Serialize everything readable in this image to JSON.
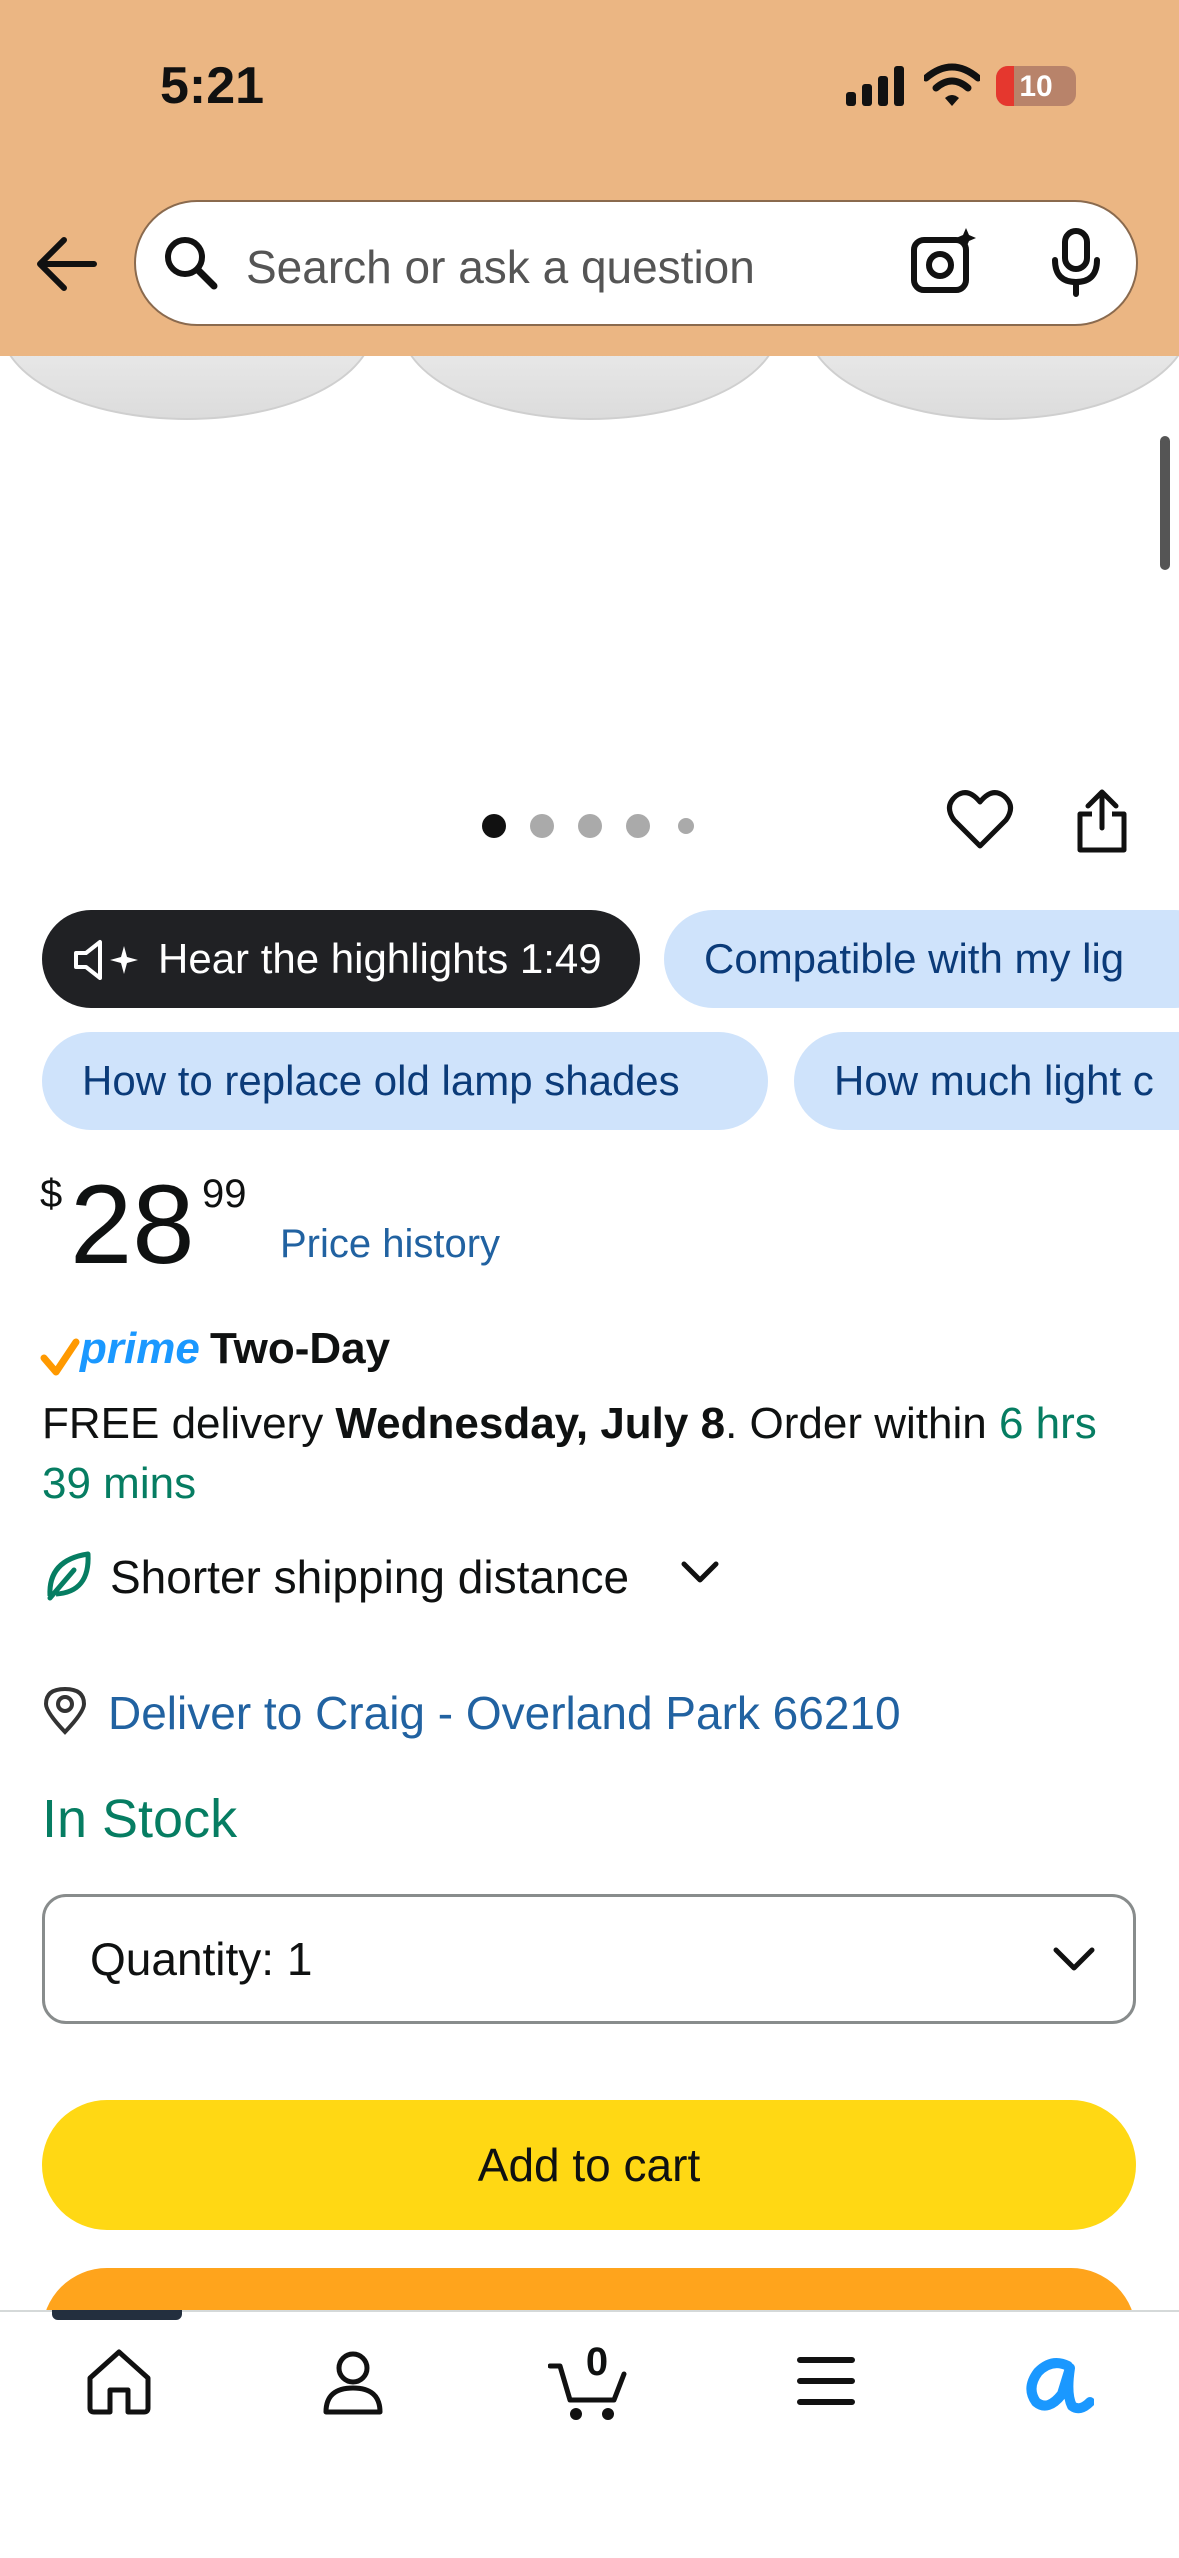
{
  "status_bar": {
    "time": "5:21",
    "battery": "10"
  },
  "search": {
    "placeholder": "Search or ask a question"
  },
  "chips": {
    "row1": [
      "Hear the highlights 1:49",
      "Compatible with my lig"
    ],
    "row2": [
      "How to replace old lamp shades",
      "How much light c"
    ]
  },
  "price": {
    "symbol": "$",
    "whole": "28",
    "fraction": "99",
    "history_link": "Price history"
  },
  "prime": {
    "badge": "prime",
    "label": "Two-Day"
  },
  "delivery": {
    "prefix": "FREE delivery ",
    "date": "Wednesday, July 8",
    "middle": ". Order within ",
    "countdown": "6 hrs 39 mins"
  },
  "shipping_note": "Shorter shipping distance",
  "deliver_to": "Deliver to Craig - Overland Park 66210",
  "stock_status": "In Stock",
  "quantity": {
    "label": "Quantity:",
    "value": "1"
  },
  "buttons": {
    "add_to_cart": "Add to cart"
  },
  "image_carousel": {
    "total": 5,
    "active": 1
  },
  "nav": {
    "cart_count": "0"
  },
  "colors": {
    "header": "#EBB683",
    "add_to_cart": "#FFD814",
    "buy_now": "#FFA41C",
    "link": "#2162A1",
    "in_stock": "#067D62",
    "chip_bg": "#CFE3FB"
  }
}
